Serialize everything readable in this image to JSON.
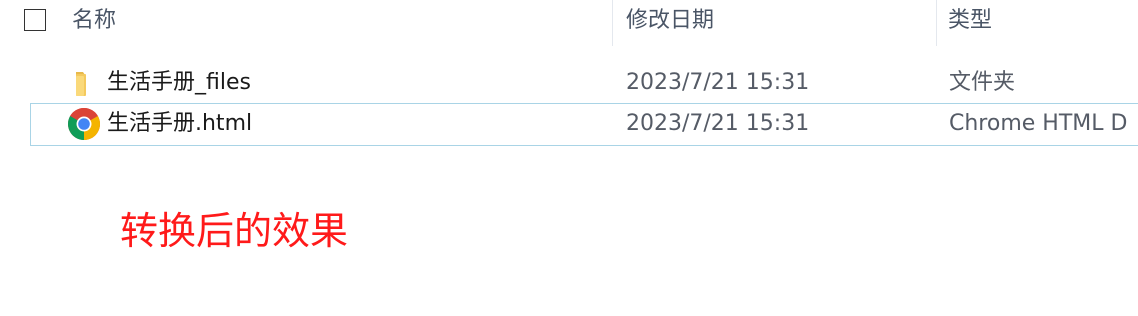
{
  "header": {
    "columns": [
      {
        "label": "名称"
      },
      {
        "label": "修改日期"
      },
      {
        "label": "类型"
      }
    ]
  },
  "files": [
    {
      "name": "生活手册_files",
      "modified": "2023/7/21 15:31",
      "type": "文件夹",
      "icon": "folder-icon"
    },
    {
      "name": "生活手册.html",
      "modified": "2023/7/21 15:31",
      "type": "Chrome HTML D",
      "icon": "chrome-icon"
    }
  ],
  "annotation": "转换后的效果",
  "colors": {
    "annotation": "#ff1a1a",
    "selection_border": "#a9d4e6",
    "header_text": "#4a5566",
    "detail_text": "#555b66"
  }
}
